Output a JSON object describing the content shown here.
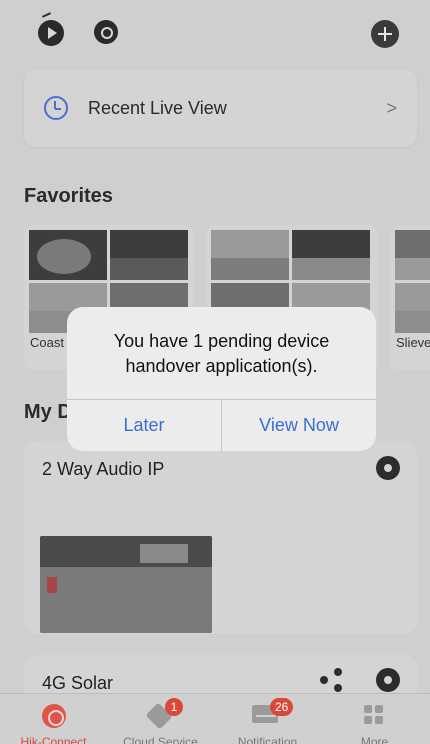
{
  "top_bar": {
    "icons": [
      "play-icon",
      "search-icon",
      "add-icon"
    ]
  },
  "recent": {
    "label": "Recent Live View"
  },
  "favorites": {
    "title": "Favorites",
    "items": [
      {
        "label": "Coast"
      },
      {
        "label": ""
      },
      {
        "label": "Slieve"
      }
    ]
  },
  "my_devices": {
    "title": "My D"
  },
  "devices": [
    {
      "name": "2 Way Audio IP"
    },
    {
      "name": "4G Solar"
    }
  ],
  "dialog": {
    "message": "You have 1 pending device handover application(s).",
    "cancel_label": "Later",
    "confirm_label": "View Now"
  },
  "tabs": [
    {
      "label": "Hik-Connect",
      "active": true,
      "badge": ""
    },
    {
      "label": "Cloud Service",
      "active": false,
      "badge": "1"
    },
    {
      "label": "Notification",
      "active": false,
      "badge": "26"
    },
    {
      "label": "More",
      "active": false,
      "badge": ""
    }
  ],
  "colors": {
    "accent_blue": "#3a6fd1",
    "brand_red": "#d9483b"
  }
}
